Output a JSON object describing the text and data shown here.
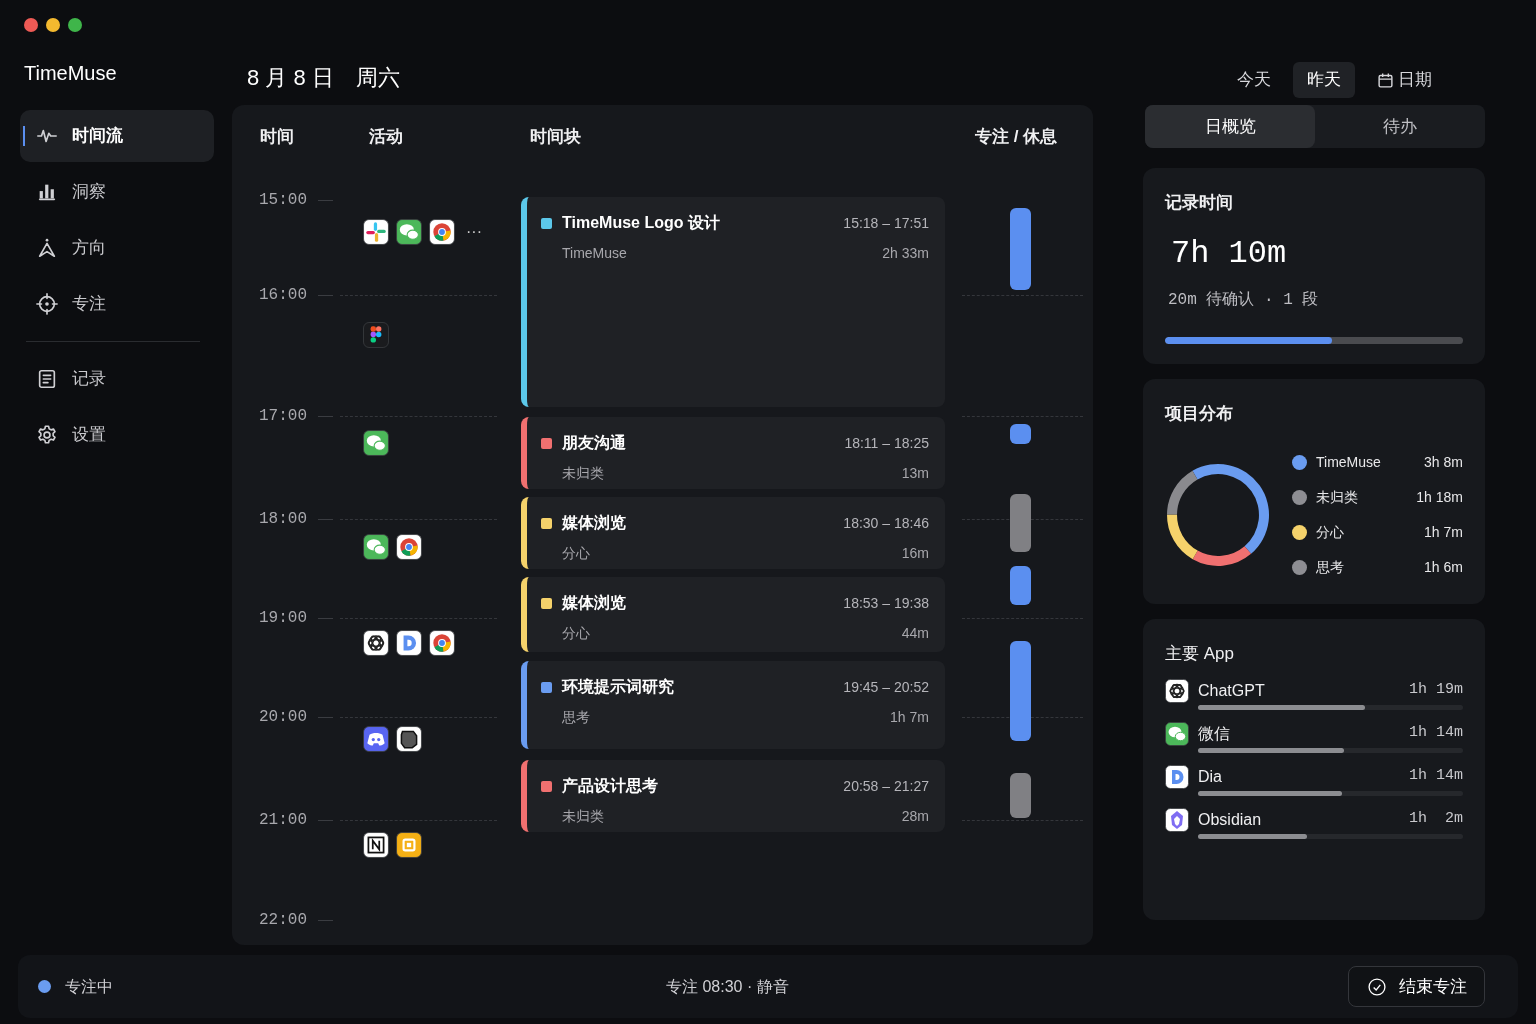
{
  "app_name": "TimeMuse",
  "sidebar": {
    "groups": [
      [
        {
          "label": "时间流",
          "kind": "pulse",
          "selected": true
        },
        {
          "label": "洞察",
          "kind": "bars",
          "selected": false
        },
        {
          "label": "方向",
          "kind": "compass",
          "selected": false
        },
        {
          "label": "专注",
          "kind": "target",
          "selected": false
        }
      ],
      [
        {
          "label": "记录",
          "kind": "document",
          "selected": false
        },
        {
          "label": "设置",
          "kind": "gear",
          "selected": false
        }
      ]
    ]
  },
  "header": {
    "date": "8 月 8 日",
    "weekday": "周六"
  },
  "day_nav": [
    {
      "label": "今天",
      "kind": "day",
      "selected": false
    },
    {
      "label": "昨天",
      "kind": "day",
      "selected": true
    },
    {
      "label": "日期",
      "kind": "picker",
      "selected": false
    }
  ],
  "timeline": {
    "columns": [
      "时间",
      "活动",
      "时间块",
      "专注 / 休息"
    ],
    "hours": [
      "15:00",
      "16:00",
      "17:00",
      "18:00",
      "19:00",
      "20:00",
      "21:00",
      "22:00"
    ],
    "activity_groups": [
      {
        "apps": [
          {
            "kind": "slack"
          },
          {
            "kind": "wechat"
          },
          {
            "kind": "chrome"
          }
        ],
        "more": "···"
      },
      {
        "apps": [
          {
            "kind": "figma"
          }
        ]
      },
      {
        "apps": [
          {
            "kind": "wechat"
          }
        ]
      },
      {
        "apps": [
          {
            "kind": "wechat"
          },
          {
            "kind": "chrome"
          }
        ]
      },
      {
        "apps": [
          {
            "kind": "chatgpt"
          },
          {
            "kind": "dia"
          },
          {
            "kind": "chrome"
          }
        ]
      },
      {
        "apps": [
          {
            "kind": "discord"
          },
          {
            "kind": "bubble"
          }
        ]
      },
      {
        "apps": [
          {
            "kind": "notion"
          },
          {
            "kind": "yellow"
          }
        ]
      }
    ],
    "blocks": [
      {
        "title": "TimeMuse Logo 设计",
        "project": "TimeMuse",
        "time": "15:18 – 17:51",
        "duration": "2h 33m",
        "color": "#5cc8ea"
      },
      {
        "title": "朋友沟通",
        "project": "未归类",
        "time": "18:11 – 18:25",
        "duration": "13m",
        "color": "#f07070"
      },
      {
        "title": "媒体浏览",
        "project": "分心",
        "time": "18:30 – 18:46",
        "duration": "16m",
        "color": "#f5d26b"
      },
      {
        "title": "媒体浏览",
        "project": "分心",
        "time": "18:53 – 19:38",
        "duration": "44m",
        "color": "#f5d26b"
      },
      {
        "title": "环境提示词研究",
        "project": "思考",
        "time": "19:45 – 20:52",
        "duration": "1h 7m",
        "color": "#6a9cf0"
      },
      {
        "title": "产品设计思考",
        "project": "未归类",
        "time": "20:58 – 21:27",
        "duration": "28m",
        "color": "#f07070"
      }
    ],
    "focus_bars": [
      {
        "kind": "focus"
      },
      {
        "kind": "focus"
      },
      {
        "kind": "rest"
      },
      {
        "kind": "focus"
      },
      {
        "kind": "focus"
      },
      {
        "kind": "rest"
      }
    ]
  },
  "panel_tabs": [
    {
      "label": "日概览",
      "selected": true
    },
    {
      "label": "待办",
      "selected": false
    }
  ],
  "recorded": {
    "title": "记录时间",
    "total": "7h 10m",
    "note": "20m 待确认 · 1 段",
    "level": 0.56
  },
  "projects": {
    "title": "项目分布",
    "chart_data": {
      "type": "donut",
      "categories": [
        "TimeMuse",
        "未归类",
        "分心",
        "思考"
      ],
      "values": [
        47.1,
        19.5,
        16.9,
        16.5
      ],
      "colors": [
        "#6a9cf0",
        "#f07070",
        "#f5d26b",
        "#8a8a8e"
      ]
    },
    "legend": [
      {
        "duration": "3h 8m",
        "color": "#6a9cf0"
      },
      {
        "duration": "1h 18m",
        "color": "#8e8e93"
      },
      {
        "duration": "1h 7m",
        "color": "#f5d26b"
      },
      {
        "duration": "1h 6m",
        "color": "#8e8e93"
      }
    ]
  },
  "top_apps": {
    "title": "主要 App",
    "items": [
      {
        "kind": "chatgpt",
        "name": "ChatGPT",
        "duration": "1h 19m",
        "level": 0.63
      },
      {
        "kind": "wechat",
        "name": "微信",
        "duration": "1h 14m",
        "level": 0.55
      },
      {
        "kind": "dia",
        "name": "Dia",
        "duration": "1h 14m",
        "level": 0.545
      },
      {
        "kind": "obsidian",
        "name": "Obsidian",
        "duration": "1h  2m",
        "level": 0.41
      }
    ]
  },
  "status_bar": {
    "state": "专注中",
    "info": "专注 08:30 · 静音",
    "button": "结束专注"
  }
}
